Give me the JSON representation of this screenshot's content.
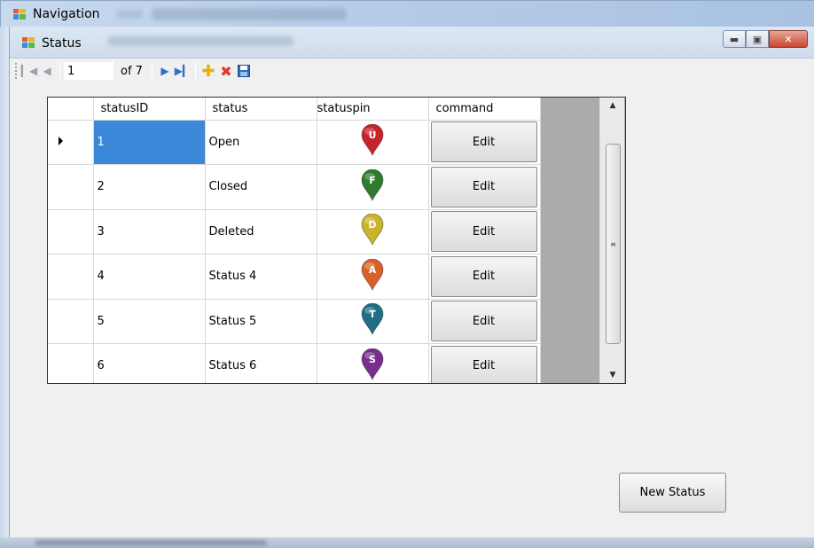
{
  "outer_window": {
    "title": "Navigation"
  },
  "window": {
    "title": "Status"
  },
  "toolbar": {
    "position_value": "1",
    "of_label": "of 7"
  },
  "grid": {
    "columns": [
      "statusID",
      "status",
      "statuspin",
      "command"
    ],
    "selected_row": 0,
    "rows": [
      {
        "statusID": "1",
        "status": "Open",
        "pin_letter": "U",
        "pin_color": "#c8232c",
        "command": "Edit"
      },
      {
        "statusID": "2",
        "status": "Closed",
        "pin_letter": "F",
        "pin_color": "#2f7a2e",
        "command": "Edit"
      },
      {
        "statusID": "3",
        "status": "Deleted",
        "pin_letter": "D",
        "pin_color": "#c9b52a",
        "command": "Edit"
      },
      {
        "statusID": "4",
        "status": "Status 4",
        "pin_letter": "A",
        "pin_color": "#d8612a",
        "command": "Edit"
      },
      {
        "statusID": "5",
        "status": "Status 5",
        "pin_letter": "T",
        "pin_color": "#1e6f86",
        "command": "Edit"
      },
      {
        "statusID": "6",
        "status": "Status 6",
        "pin_letter": "S",
        "pin_color": "#7a2e8c",
        "command": "Edit"
      }
    ]
  },
  "new_status_button": {
    "label": "New Status"
  },
  "icons": {
    "move_first": "move-first-icon",
    "move_previous": "move-previous-icon",
    "move_next": "move-next-icon",
    "move_last": "move-last-icon",
    "add": "add-icon",
    "delete": "delete-icon",
    "save": "save-icon"
  }
}
